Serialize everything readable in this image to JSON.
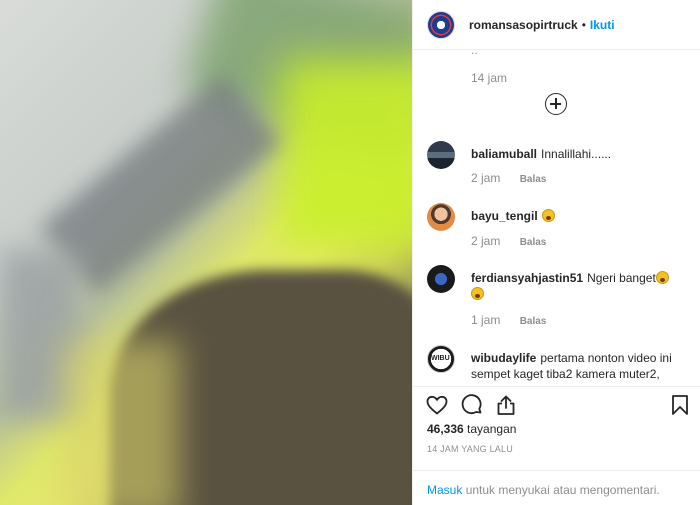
{
  "post": {
    "username": "romansasopirtruck",
    "separator": "•",
    "follow_label": "Ikuti"
  },
  "comments_area": {
    "partial_top": "..",
    "top_time": "14 jam",
    "load_more_icon": "plus-circle-icon"
  },
  "comments": [
    {
      "username": "baliamuball",
      "text": "Innalillahi......",
      "emoji_after": false,
      "time": "2 jam",
      "reply_label": "Balas"
    },
    {
      "username": "bayu_tengil",
      "text": "",
      "emoji_after": true,
      "time": "2 jam",
      "reply_label": "Balas"
    },
    {
      "username": "ferdiansyahjastin51",
      "text": "Ngeri banget",
      "emoji_after": true,
      "time": "1 jam",
      "reply_label": "Balas"
    },
    {
      "username": "wibudaylife",
      "text": "pertama nonton video ini sempet kaget tiba2 kamera muter2,",
      "emoji_after": false
    }
  ],
  "actions": {
    "like_icon": "heart-icon",
    "comment_icon": "comment-icon",
    "share_icon": "share-icon",
    "save_icon": "bookmark-icon",
    "views_count": "46,336",
    "views_label": "tayangan",
    "posted_ago": "14 JAM YANG LALU"
  },
  "login_bar": {
    "link_label": "Masuk",
    "rest_text": "untuk menyukai atau mengomentari."
  },
  "colors": {
    "link": "#0095f6",
    "muted": "#8e8e8e",
    "text": "#262626",
    "divider": "#efefef"
  }
}
